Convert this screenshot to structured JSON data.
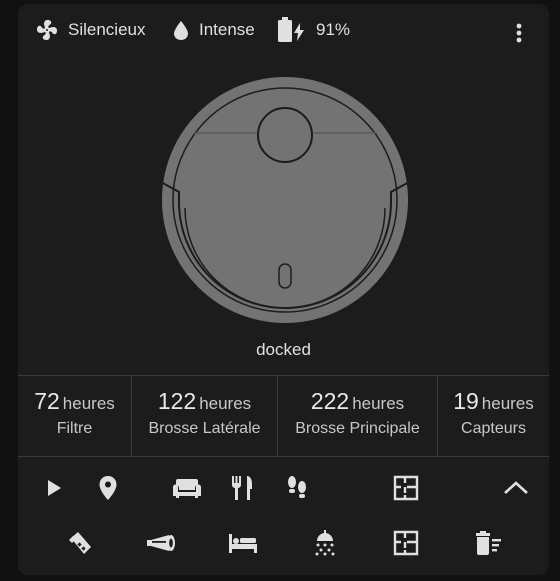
{
  "header": {
    "fan_speed": "Silencieux",
    "water_level": "Intense",
    "battery": "91%",
    "icons": {
      "fan": "fan-icon",
      "water": "water-drop-icon",
      "battery": "battery-charging-icon",
      "menu": "more-vertical-icon"
    }
  },
  "robot": {
    "status": "docked",
    "illustration": "robot-vacuum"
  },
  "stats": [
    {
      "value": "72",
      "unit": "heures",
      "label": "Filtre"
    },
    {
      "value": "122",
      "unit": "heures",
      "label": "Brosse Latérale"
    },
    {
      "value": "222",
      "unit": "heures",
      "label": "Brosse Principale"
    },
    {
      "value": "19",
      "unit": "heures",
      "label": "Capteurs"
    }
  ],
  "actions_row1": [
    "play-icon",
    "locate-icon",
    "sofa-icon",
    "dining-icon",
    "footprints-icon",
    "floor-plan-icon",
    "chevron-up-icon"
  ],
  "actions_row2": [
    "spray-icon",
    "horn-icon",
    "bed-icon",
    "shower-icon",
    "floor-plan-icon",
    "trash-list-icon"
  ],
  "colors": {
    "background": "#111111",
    "card": "#1c1c1c",
    "text": "#e1e1e1",
    "icon": "#e0e0e0",
    "robot_fill": "#737373",
    "robot_stroke": "#1c1c1c"
  }
}
